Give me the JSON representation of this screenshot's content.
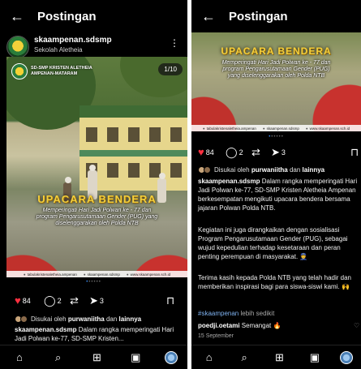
{
  "left": {
    "topbar": {
      "back_icon": "arrow-left-icon",
      "title": "Postingan"
    },
    "post": {
      "username": "skaampenan.sdsmp",
      "location": "Sekolah Aletheia",
      "more_icon": "more-vertical-icon",
      "photo": {
        "badge_text": "SD-SMP KRISTEN ALETHEIA AMPENAN-MATARAM",
        "counter": "1/10",
        "overlay_title": "UPACARA BENDERA",
        "overlay_sub": "Memperingati Hari Jadi Polwan ke - 77 dan program Pengarusutamaan Gender (PUG) yang diselenggarakan oleh Polda NTB",
        "socials": [
          "tabulakristenaletheia.ampenan",
          "skaampenan.sdsmp",
          "www.skaampenan.sch.id"
        ]
      },
      "actions": {
        "likes": "84",
        "comments": "2",
        "shares": "3"
      },
      "liked_by_prefix": "Disukai oleh",
      "liked_by_user": "purwaniitha",
      "liked_by_conj": "dan",
      "liked_by_others": "lainnya",
      "caption_user": "skaampenan.sdsmp",
      "caption_text": "Dalam rangka memperingati Hari Jadi Polwan ke-77, SD-SMP Kristen..."
    }
  },
  "right": {
    "topbar": {
      "back_icon": "arrow-left-icon",
      "title": "Postingan"
    },
    "post": {
      "photo": {
        "overlay_title": "UPACARA BENDERA",
        "overlay_sub": "Memperingati Hari Jadi Polwan ke - 77 dan program Pengarusutamaan Gender (PUG) yang diselenggarakan oleh Polda NTB",
        "socials": [
          "tabulakristenaletheia.ampenan",
          "skaampenan.sdsmp",
          "www.skaampenan.sch.id"
        ]
      },
      "actions": {
        "likes": "84",
        "comments": "2",
        "shares": "3"
      },
      "liked_by_prefix": "Disukai oleh",
      "liked_by_user": "purwaniitha",
      "liked_by_conj": "dan",
      "liked_by_others": "lainnya",
      "caption_user": "skaampenan.sdsmp",
      "caption_p1": "Dalam rangka memperingati Hari Jadi Polwan ke-77, SD-SMP Kristen Aletheia Ampenan berkesempatan mengikuti upacara bendera bersama jajaran Polwan Polda NTB.",
      "caption_p2": "Kegiatan ini juga dirangkaikan dengan sosialisasi Program Pengarusutamaan Gender (PUG), sebagai wujud kepedulian terhadap kesetaraan dan peran penting perempuan di masyarakat. 👮",
      "caption_p3": "Terima kasih kepada Polda NTB yang telah hadir dan memberikan inspirasi bagi para siswa-siswi kami. 🙌",
      "hashtag": "#skaampenan",
      "more_label": "lebih sedikit",
      "comment_user": "poedji.oetami",
      "comment_text": "Semangat 🔥",
      "date": "15 September"
    }
  },
  "bottom_nav": [
    "home-icon",
    "search-icon",
    "create-icon",
    "reels-icon",
    "profile-avatar"
  ]
}
